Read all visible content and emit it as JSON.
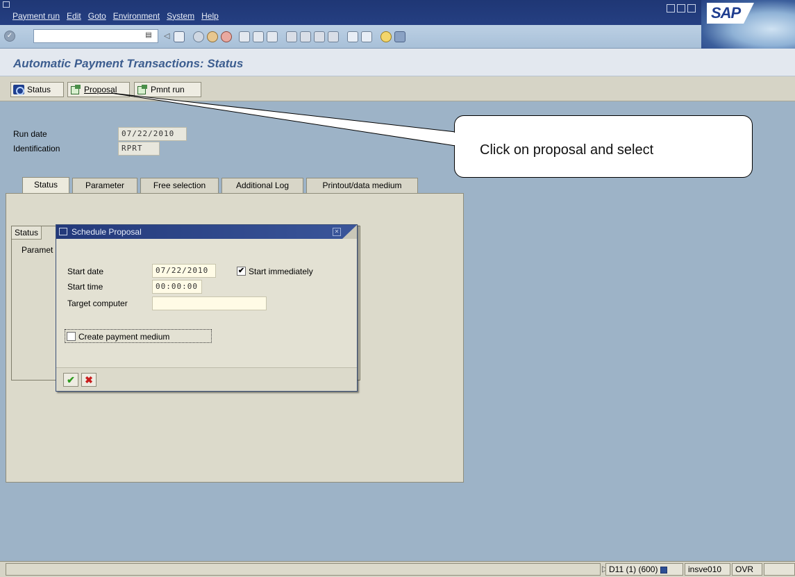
{
  "menubar": {
    "items": [
      "Payment run",
      "Edit",
      "Goto",
      "Environment",
      "System",
      "Help"
    ]
  },
  "logo": {
    "text": "SAP"
  },
  "page": {
    "title": "Automatic Payment Transactions: Status"
  },
  "app_toolbar": {
    "status_label": "Status",
    "proposal_label": "Proposal",
    "pmnt_run_label": "Pmnt run"
  },
  "header": {
    "run_date_label": "Run date",
    "run_date_value": "07/22/2010",
    "identification_label": "Identification",
    "identification_value": "RPRT"
  },
  "tabs": [
    "Status",
    "Parameter",
    "Free selection",
    "Additional Log",
    "Printout/data medium"
  ],
  "inner": {
    "tab_label": "Status",
    "param_label": "Paramet"
  },
  "dialog": {
    "title": "Schedule Proposal",
    "start_date_label": "Start date",
    "start_date_value": "07/22/2010",
    "start_immediately_label": "Start immediately",
    "start_immediately_checked": true,
    "start_time_label": "Start time",
    "start_time_value": "00:00:00",
    "target_computer_label": "Target computer",
    "target_computer_value": "",
    "create_payment_medium_label": "Create payment medium",
    "create_payment_medium_checked": false
  },
  "callout": {
    "text": "Click on proposal and select"
  },
  "statusbar": {
    "system": "D11 (1) (600)",
    "server": "insve010",
    "mode": "OVR"
  },
  "colors": {
    "menubar": "#253f82",
    "title_text": "#3c5d8f",
    "background": "#9db3c7",
    "panel": "#dcdacb",
    "ok_check": "#2e9b1e",
    "cancel_x": "#c81e1e"
  }
}
